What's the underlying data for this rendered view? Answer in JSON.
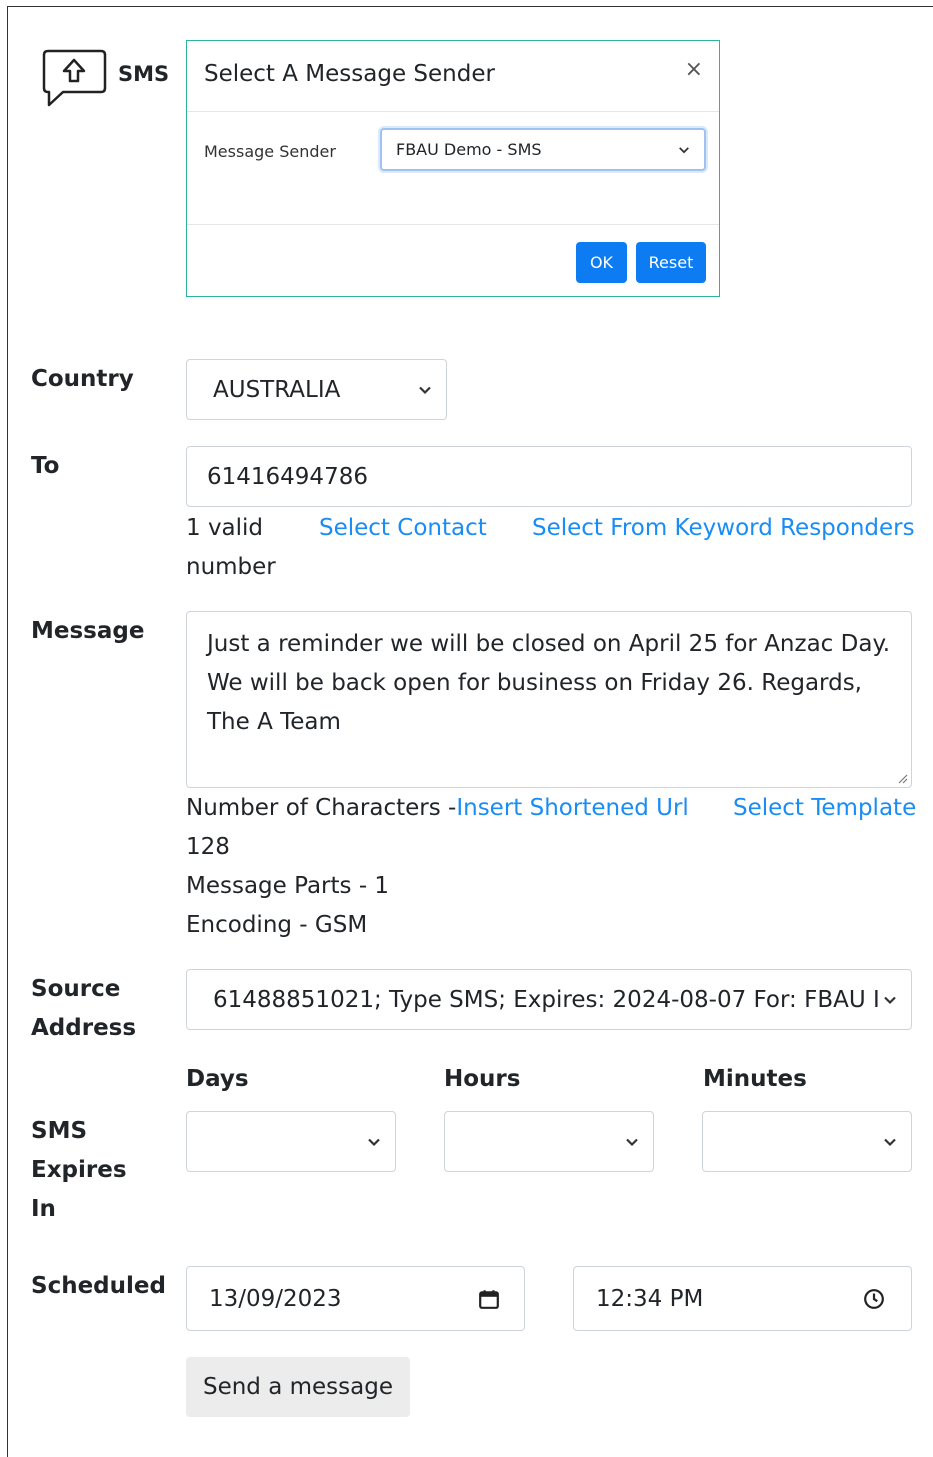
{
  "app": {
    "name": "SMS",
    "icon": "sms-upload-icon"
  },
  "modal": {
    "title": "Select A Message Sender",
    "close_label": "×",
    "sender_label": "Message Sender",
    "sender_value": "FBAU Demo - SMS",
    "ok_label": "OK",
    "reset_label": "Reset"
  },
  "form": {
    "country_label": "Country",
    "country_value": "AUSTRALIA",
    "to_label": "To",
    "to_value": "61416494786",
    "valid_line1": "1 valid",
    "valid_line2": "number",
    "select_contact": "Select Contact",
    "select_keyword": "Select From Keyword Responders",
    "message_label": "Message",
    "message_value": "Just a reminder we will be closed on April 25 for Anzac Day. We will be back open for business on Friday 26. Regards, The A Team",
    "chars_label": "Number of Characters -",
    "chars_value": "128",
    "insert_url": "Insert Shortened Url",
    "select_template": "Select Template",
    "parts": "Message Parts - 1",
    "encoding": "Encoding - GSM",
    "source_label_1": "Source",
    "source_label_2": "Address",
    "source_value": "61488851021; Type SMS; Expires: 2024-08-07 For: FBAU I",
    "expires_label_1": "SMS",
    "expires_label_2": "Expires",
    "expires_label_3": "In",
    "days_label": "Days",
    "hours_label": "Hours",
    "minutes_label": "Minutes",
    "scheduled_label": "Scheduled",
    "date_value": "13/09/2023",
    "time_value": "12:34 PM",
    "send_label": "Send a message"
  },
  "colors": {
    "link": "#1a8cf5",
    "primary": "#0d7cf2",
    "modal_border": "#2bb39b"
  }
}
